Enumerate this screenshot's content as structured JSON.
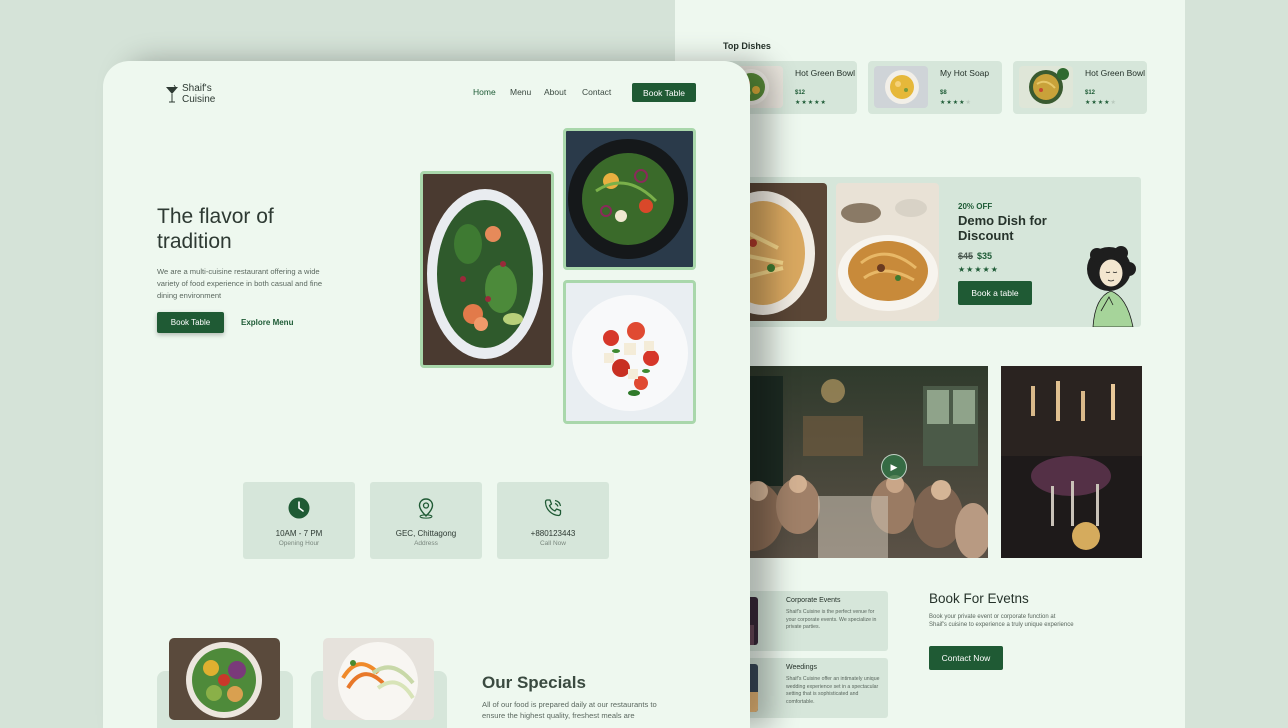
{
  "front": {
    "logo": {
      "line1": "Shaif's",
      "line2": "Cuisine"
    },
    "nav": {
      "home": "Home",
      "menu": "Menu",
      "about": "About",
      "contact": "Contact",
      "book": "Book Table"
    },
    "hero": {
      "title_line1": "The flavor of",
      "title_line2": "tradition",
      "description": "We are a multi-cuisine restaurant offering a wide variety of food experience in both casual and fine dining environment",
      "book_button": "Book Table",
      "explore_link": "Explore Menu"
    },
    "info": [
      {
        "title": "10AM - 7 PM",
        "sub": "Opening Hour",
        "icon": "clock-icon"
      },
      {
        "title": "GEC, Chittagong",
        "sub": "Address",
        "icon": "location-pin-icon"
      },
      {
        "title": "+880123443",
        "sub": "Call Now",
        "icon": "phone-icon"
      }
    ],
    "specials": {
      "title": "Our Specials",
      "description": "All of our food is prepared daily at our restaurants to ensure the highest quality, freshest meals are"
    }
  },
  "back": {
    "top_dishes_title": "Top Dishes",
    "dishes": [
      {
        "name": "Hot Green Bowl",
        "price": "$12",
        "rating": 5
      },
      {
        "name": "My Hot Soap",
        "price": "$8",
        "rating": 4
      },
      {
        "name": "Hot Green Bowl",
        "price": "$12",
        "rating": 4
      }
    ],
    "promo": {
      "off": "20% OFF",
      "title": "Demo Dish for Discount",
      "old_price": "$45",
      "new_price": "$35",
      "stars": "★★★★★",
      "button": "Book a table"
    },
    "events": [
      {
        "title": "Corporate Events",
        "desc": "Shaif's Cuisine is the perfect venue for your corporate events. We specialize in private parties."
      },
      {
        "title": "Weedings",
        "desc": "Shaif's Cuisine offer an intimately unique wedding experience set in a spectacular setting that is sophisticated and comfortable."
      }
    ],
    "book_events": {
      "title": "Book For Evetns",
      "desc": "Book your private event or corporate function at Shaif's cuisine to experience a truly unique experience",
      "button": "Contact Now"
    }
  },
  "colors": {
    "accent": "#1f5a34",
    "page_bg": "#eef8ef",
    "card_bg": "#d6e6da",
    "outer_bg": "#d5e3d8",
    "image_border": "#a9d7ab"
  }
}
